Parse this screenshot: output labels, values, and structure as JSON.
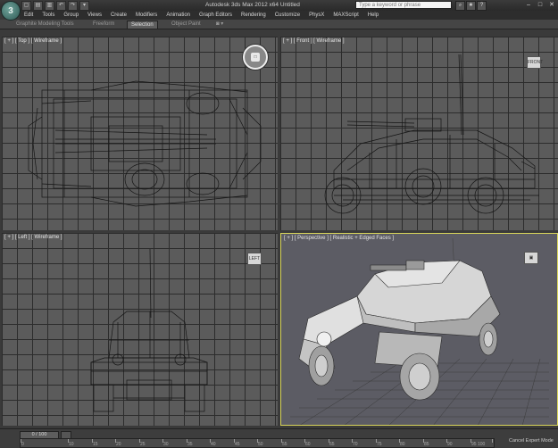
{
  "titlebar": {
    "app_logo_letter": "3",
    "title": "Autodesk 3ds Max  2012 x64       Untitled",
    "search_placeholder": "Type a keyword or phrase",
    "minimize": "–",
    "maximize": "□",
    "close": "✕"
  },
  "quick_access": [
    "▢",
    "▤",
    "▥",
    "↶",
    "↷",
    "▾"
  ],
  "menu": [
    "Edit",
    "Tools",
    "Group",
    "Views",
    "Create",
    "Modifiers",
    "Animation",
    "Graph Editors",
    "Rendering",
    "Customize",
    "PhysX",
    "MAXScript",
    "Help"
  ],
  "ribbon_tabs": {
    "graphite": "Graphite Modeling Tools",
    "freeform": "Freeform",
    "selection": "Selection",
    "object_paint": "Object Paint",
    "more": "◙ ▾"
  },
  "viewports": {
    "top": {
      "label": "[ + ] [ Top ] [ Wireframe ]"
    },
    "front": {
      "label": "[ + ] [ Front ] [ Wireframe ]",
      "cube": "FRONT"
    },
    "left": {
      "label": "[ + ] [ Left ] [ Wireframe ]",
      "cube": "LEFT"
    },
    "perspective": {
      "label": "[ + ] [ Perspective ] [ Realistic + Edged Faces ]"
    }
  },
  "timeline": {
    "frame_counter": "0 / 100",
    "ticks": [
      "0",
      "10",
      "15",
      "20",
      "25",
      "30",
      "35",
      "40",
      "45",
      "50",
      "55",
      "60",
      "65",
      "70",
      "75",
      "80",
      "85",
      "90",
      "95",
      "100"
    ]
  },
  "status": {
    "mode": "Cancel Expert Mode"
  },
  "colors": {
    "viewport_grid": "#5b5b5b",
    "active_border": "#d8d45a",
    "wire": "#141414"
  }
}
